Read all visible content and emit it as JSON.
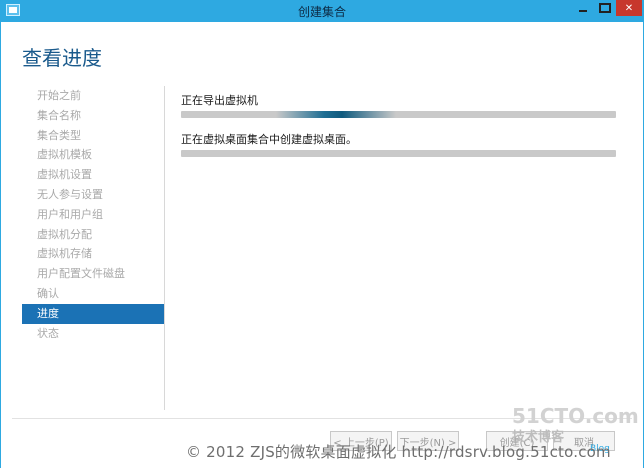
{
  "window": {
    "title": "创建集合",
    "controls": {
      "minimize": "minimize",
      "maximize": "maximize",
      "close": "✕"
    }
  },
  "page_title": "查看进度",
  "nav": {
    "items": [
      {
        "label": "开始之前",
        "active": false
      },
      {
        "label": "集合名称",
        "active": false
      },
      {
        "label": "集合类型",
        "active": false
      },
      {
        "label": "虚拟机模板",
        "active": false
      },
      {
        "label": "虚拟机设置",
        "active": false
      },
      {
        "label": "无人参与设置",
        "active": false
      },
      {
        "label": "用户和用户组",
        "active": false
      },
      {
        "label": "虚拟机分配",
        "active": false
      },
      {
        "label": "虚拟机存储",
        "active": false
      },
      {
        "label": "用户配置文件磁盘",
        "active": false
      },
      {
        "label": "确认",
        "active": false
      },
      {
        "label": "进度",
        "active": true
      },
      {
        "label": "状态",
        "active": false
      }
    ]
  },
  "tasks": [
    {
      "label": "正在导出虚拟机",
      "progress": "indeterminate"
    },
    {
      "label": "正在虚拟桌面集合中创建虚拟桌面。",
      "progress": 0
    }
  ],
  "footer": {
    "prev": "< 上一步(P)",
    "next": "下一步(N) >",
    "create": "创建(C)",
    "cancel": "取消"
  },
  "watermark": {
    "text": "© 2012 ZJS的微软桌面虚拟化 http://rdsrv.blog.51cto.com",
    "logo": "51CTO.com",
    "logo_sub": "技术博客",
    "logo_tag": "Blog"
  },
  "colors": {
    "titlebar": "#2ea9e1",
    "accent": "#1b72b5",
    "close": "#c7372c",
    "heading": "#1a5a8c"
  }
}
